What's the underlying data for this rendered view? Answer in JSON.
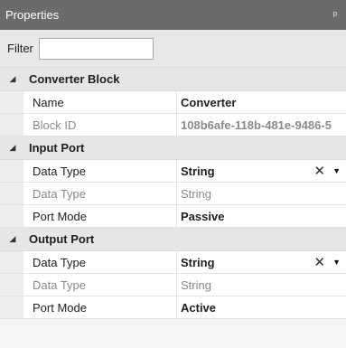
{
  "panel": {
    "title": "Properties",
    "pin_icon": "ᵖ"
  },
  "filter": {
    "label": "Filter",
    "value": ""
  },
  "categories": [
    {
      "title": "Converter Block",
      "rows": [
        {
          "name": "Name",
          "value": "Converter"
        },
        {
          "name": "Block ID",
          "value": "108b6afe-118b-481e-9486-5"
        }
      ]
    },
    {
      "title": "Input Port",
      "rows": [
        {
          "name": "Data Type",
          "value": "String"
        },
        {
          "name": "Data Type",
          "value": "String"
        },
        {
          "name": "Port Mode",
          "value": "Passive"
        }
      ]
    },
    {
      "title": "Output Port",
      "rows": [
        {
          "name": "Data Type",
          "value": "String"
        },
        {
          "name": "Data Type",
          "value": "String"
        },
        {
          "name": "Port Mode",
          "value": "Active"
        }
      ]
    }
  ],
  "glyphs": {
    "collapse": "◢",
    "clear": "✕",
    "dropdown": "▼"
  }
}
